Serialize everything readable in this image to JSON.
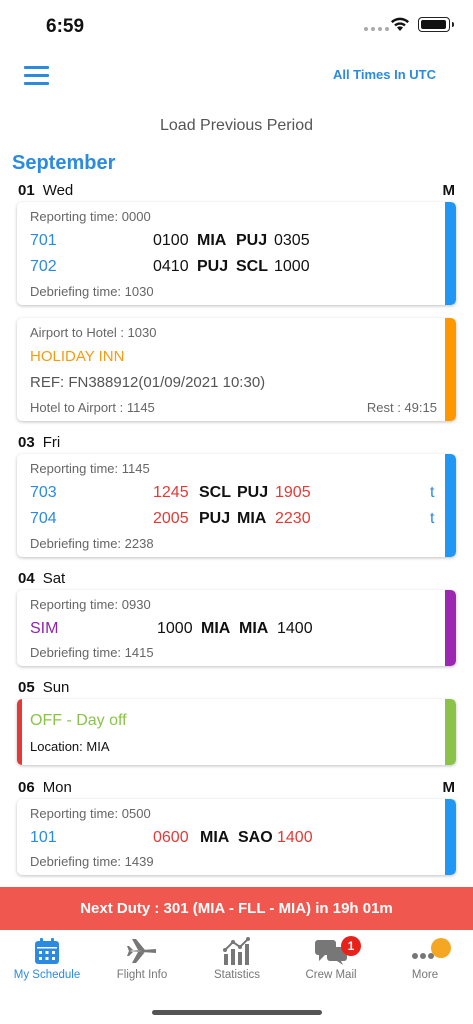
{
  "status_bar": {
    "time": "6:59"
  },
  "header": {
    "utc_label": "All Times In UTC"
  },
  "load_previous": "Load Previous Period",
  "month": "September",
  "days": [
    {
      "num": "01",
      "name": "Wed",
      "flag": "M",
      "duty": {
        "reporting": "Reporting time: 0000",
        "flights": [
          {
            "flight": "701",
            "dep_time": "0100",
            "from": "MIA",
            "to": "PUJ",
            "arr_time": "0305"
          },
          {
            "flight": "702",
            "dep_time": "0410",
            "from": "PUJ",
            "to": "SCL",
            "arr_time": "1000"
          }
        ],
        "debriefing": "Debriefing time: 1030"
      },
      "hotel": {
        "to_hotel": "Airport to Hotel : 1030",
        "name": "HOLIDAY INN",
        "ref": "REF: FN388912(01/09/2021 10:30)",
        "to_airport": "Hotel to Airport : 1145",
        "rest": "Rest : 49:15"
      }
    },
    {
      "num": "03",
      "name": "Fri",
      "duty": {
        "reporting": "Reporting time: 1145",
        "flights": [
          {
            "flight": "703",
            "dep_time": "1245",
            "from": "SCL",
            "to": "PUJ",
            "arr_time": "1905",
            "mark": "t"
          },
          {
            "flight": "704",
            "dep_time": "2005",
            "from": "PUJ",
            "to": "MIA",
            "arr_time": "2230",
            "mark": "t"
          }
        ],
        "debriefing": "Debriefing time: 2238"
      }
    },
    {
      "num": "04",
      "name": "Sat",
      "duty": {
        "reporting": "Reporting time: 0930",
        "flights": [
          {
            "flight": "SIM",
            "dep_time": "1000",
            "from": "MIA",
            "to": "MIA",
            "arr_time": "1400"
          }
        ],
        "debriefing": "Debriefing time: 1415"
      }
    },
    {
      "num": "05",
      "name": "Sun",
      "off": {
        "label": "OFF - Day off",
        "location": "Location: MIA"
      }
    },
    {
      "num": "06",
      "name": "Mon",
      "flag": "M",
      "duty": {
        "reporting": "Reporting time: 0500",
        "flights": [
          {
            "flight": "101",
            "dep_time": "0600",
            "from": "MIA",
            "to": "SAO",
            "arr_time": "1400"
          }
        ],
        "debriefing": "Debriefing time: 1439"
      }
    }
  ],
  "next_duty": "Next Duty : 301 (MIA  - FLL - MIA) in 19h 01m",
  "tabs": [
    {
      "label": "My Schedule",
      "icon": "calendar-icon",
      "active": true
    },
    {
      "label": "Flight Info",
      "icon": "airplane-icon"
    },
    {
      "label": "Statistics",
      "icon": "chart-icon"
    },
    {
      "label": "Crew Mail",
      "icon": "chat-icon",
      "badge": "1"
    },
    {
      "label": "More",
      "icon": "more-icon"
    }
  ],
  "colors": {
    "accent": "#2b8be0",
    "flight_bar": "#2196f3",
    "hotel_bar": "#ff9800",
    "sim_bar": "#9c27b0",
    "off_bar": "#8bc34a",
    "off_left": "#e53935",
    "next_duty_bg": "#f0574e"
  }
}
